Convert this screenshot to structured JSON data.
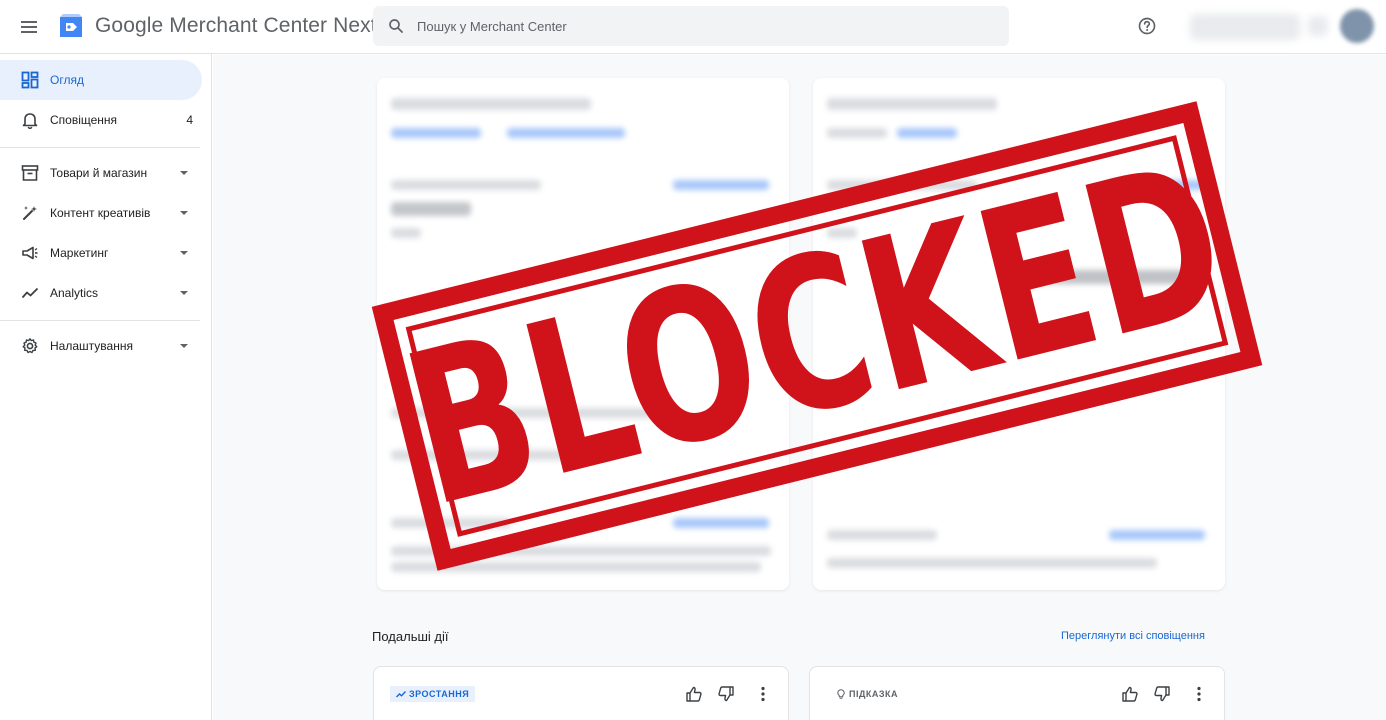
{
  "app": {
    "title": "Google Merchant Center Next",
    "search_placeholder": "Пошук у Merchant Center"
  },
  "header_icons": [
    "menu-icon",
    "merchant-logo-icon",
    "search-icon",
    "help-icon"
  ],
  "sidebar": {
    "items": [
      {
        "label": "Огляд",
        "icon": "overview-icon",
        "active": true
      },
      {
        "label": "Сповіщення",
        "icon": "bell-icon",
        "badge": "4"
      },
      {
        "label": "Товари й магазин",
        "icon": "store-icon",
        "expandable": true
      },
      {
        "label": "Контент креативів",
        "icon": "creative-wand-icon",
        "expandable": true
      },
      {
        "label": "Маркетинг",
        "icon": "megaphone-icon",
        "expandable": true
      },
      {
        "label": "Analytics",
        "icon": "trending-icon",
        "expandable": true
      },
      {
        "label": "Налаштування",
        "icon": "gear-icon",
        "expandable": true
      }
    ]
  },
  "main": {
    "next_actions": {
      "title": "Подальші дії",
      "view_all": "Переглянути всі сповіщення",
      "cards": [
        {
          "chip": "ЗРОСТАННЯ",
          "chip_icon": "trending-up-icon"
        },
        {
          "chip": "ПІДКАЗКА",
          "chip_icon": "lightbulb-icon"
        }
      ]
    }
  },
  "overlay": {
    "stamp_text": "BLOCKED",
    "color": "#d0121b"
  },
  "colors": {
    "accent": "#1967d2",
    "active_bg": "#e8f0fe"
  }
}
